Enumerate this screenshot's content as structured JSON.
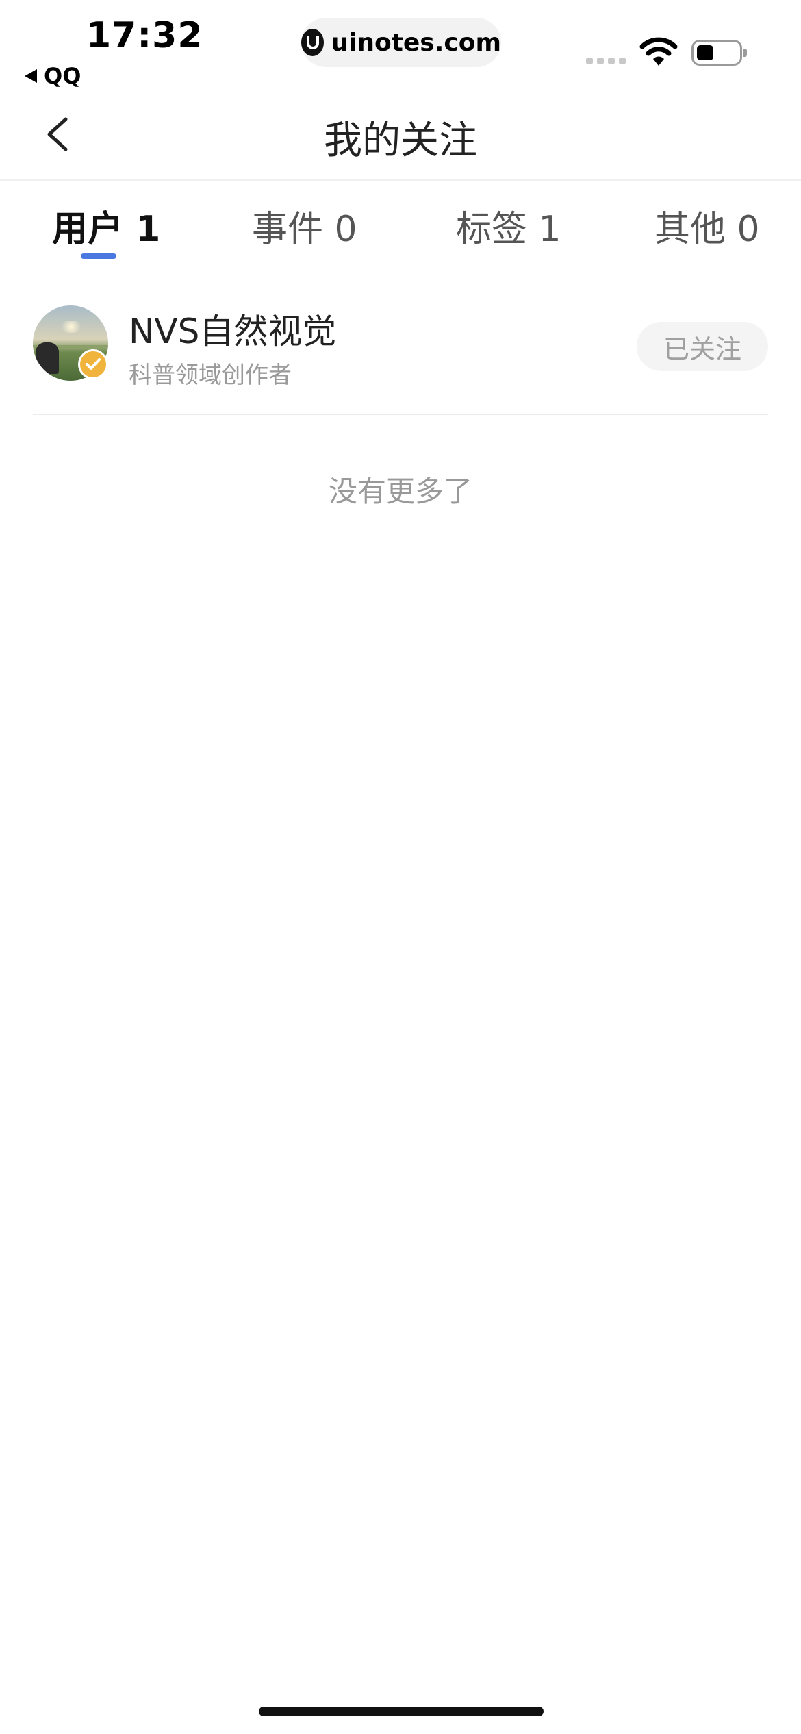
{
  "status_bar": {
    "time": "17:32",
    "back_app": "QQ",
    "url": "uinotes.com",
    "icons": [
      "signal-icon",
      "wifi-icon",
      "battery-icon"
    ]
  },
  "header": {
    "title": "我的关注",
    "back_icon": "chevron-left-icon"
  },
  "tabs": [
    {
      "label": "用户 1",
      "active": true
    },
    {
      "label": "事件 0",
      "active": false
    },
    {
      "label": "标签 1",
      "active": false
    },
    {
      "label": "其他 0",
      "active": false
    }
  ],
  "users": [
    {
      "name": "NVS自然视觉",
      "description": "科普领域创作者",
      "follow_label": "已关注",
      "verified": true
    }
  ],
  "footer_text": "没有更多了",
  "colors": {
    "accent": "#4a78e0",
    "badge": "#f0b43c",
    "muted_text": "#9a9a9a"
  }
}
